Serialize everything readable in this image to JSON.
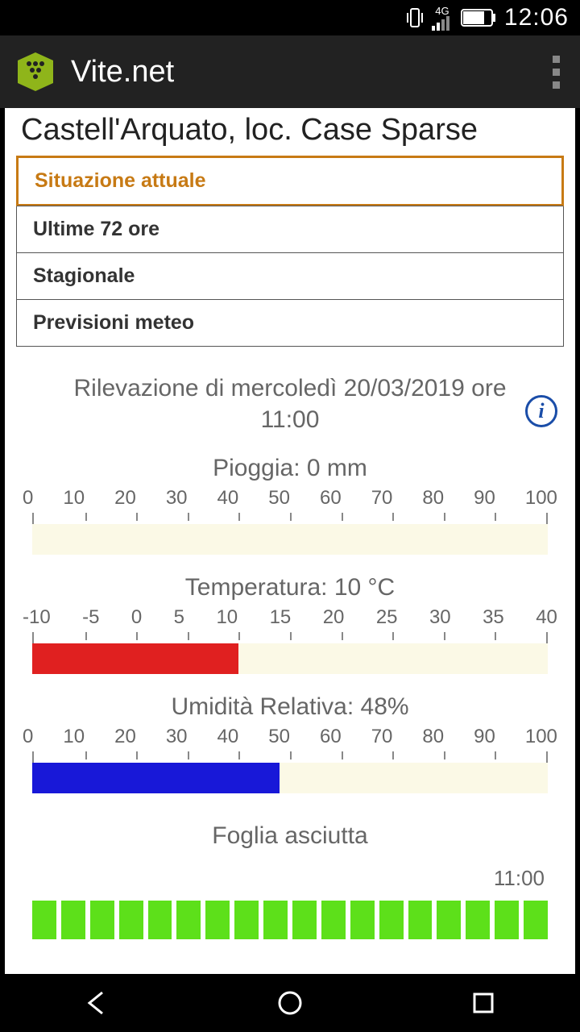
{
  "status": {
    "time": "12:06",
    "network": "4G"
  },
  "app": {
    "name": "Vite.net"
  },
  "page": {
    "title": "Castell'Arquato, loc. Case Sparse"
  },
  "tabs": {
    "items": [
      {
        "label": "Situazione attuale",
        "active": true
      },
      {
        "label": "Ultime 72 ore",
        "active": false
      },
      {
        "label": "Stagionale",
        "active": false
      },
      {
        "label": "Previsioni meteo",
        "active": false
      }
    ]
  },
  "reading": {
    "header_line1": "Rilevazione di mercoledì 20/03/2019 ore",
    "header_line2": "11:00"
  },
  "leaf": {
    "label": "Foglia asciutta",
    "time": "11:00"
  },
  "chart_data": [
    {
      "type": "bar",
      "title": "Pioggia: 0 mm",
      "categories": [
        "0",
        "10",
        "20",
        "30",
        "40",
        "50",
        "60",
        "70",
        "80",
        "90",
        "100"
      ],
      "min": 0,
      "max": 100,
      "value": 0,
      "color": "#fbf9e6"
    },
    {
      "type": "bar",
      "title": "Temperatura: 10 °C",
      "categories": [
        "-10",
        "-5",
        "0",
        "5",
        "10",
        "15",
        "20",
        "25",
        "30",
        "35",
        "40"
      ],
      "min": -10,
      "max": 40,
      "value": 10,
      "color": "#e02020"
    },
    {
      "type": "bar",
      "title": "Umidità Relativa: 48%",
      "categories": [
        "0",
        "10",
        "20",
        "30",
        "40",
        "50",
        "60",
        "70",
        "80",
        "90",
        "100"
      ],
      "min": 0,
      "max": 100,
      "value": 48,
      "color": "#1818d8"
    }
  ]
}
